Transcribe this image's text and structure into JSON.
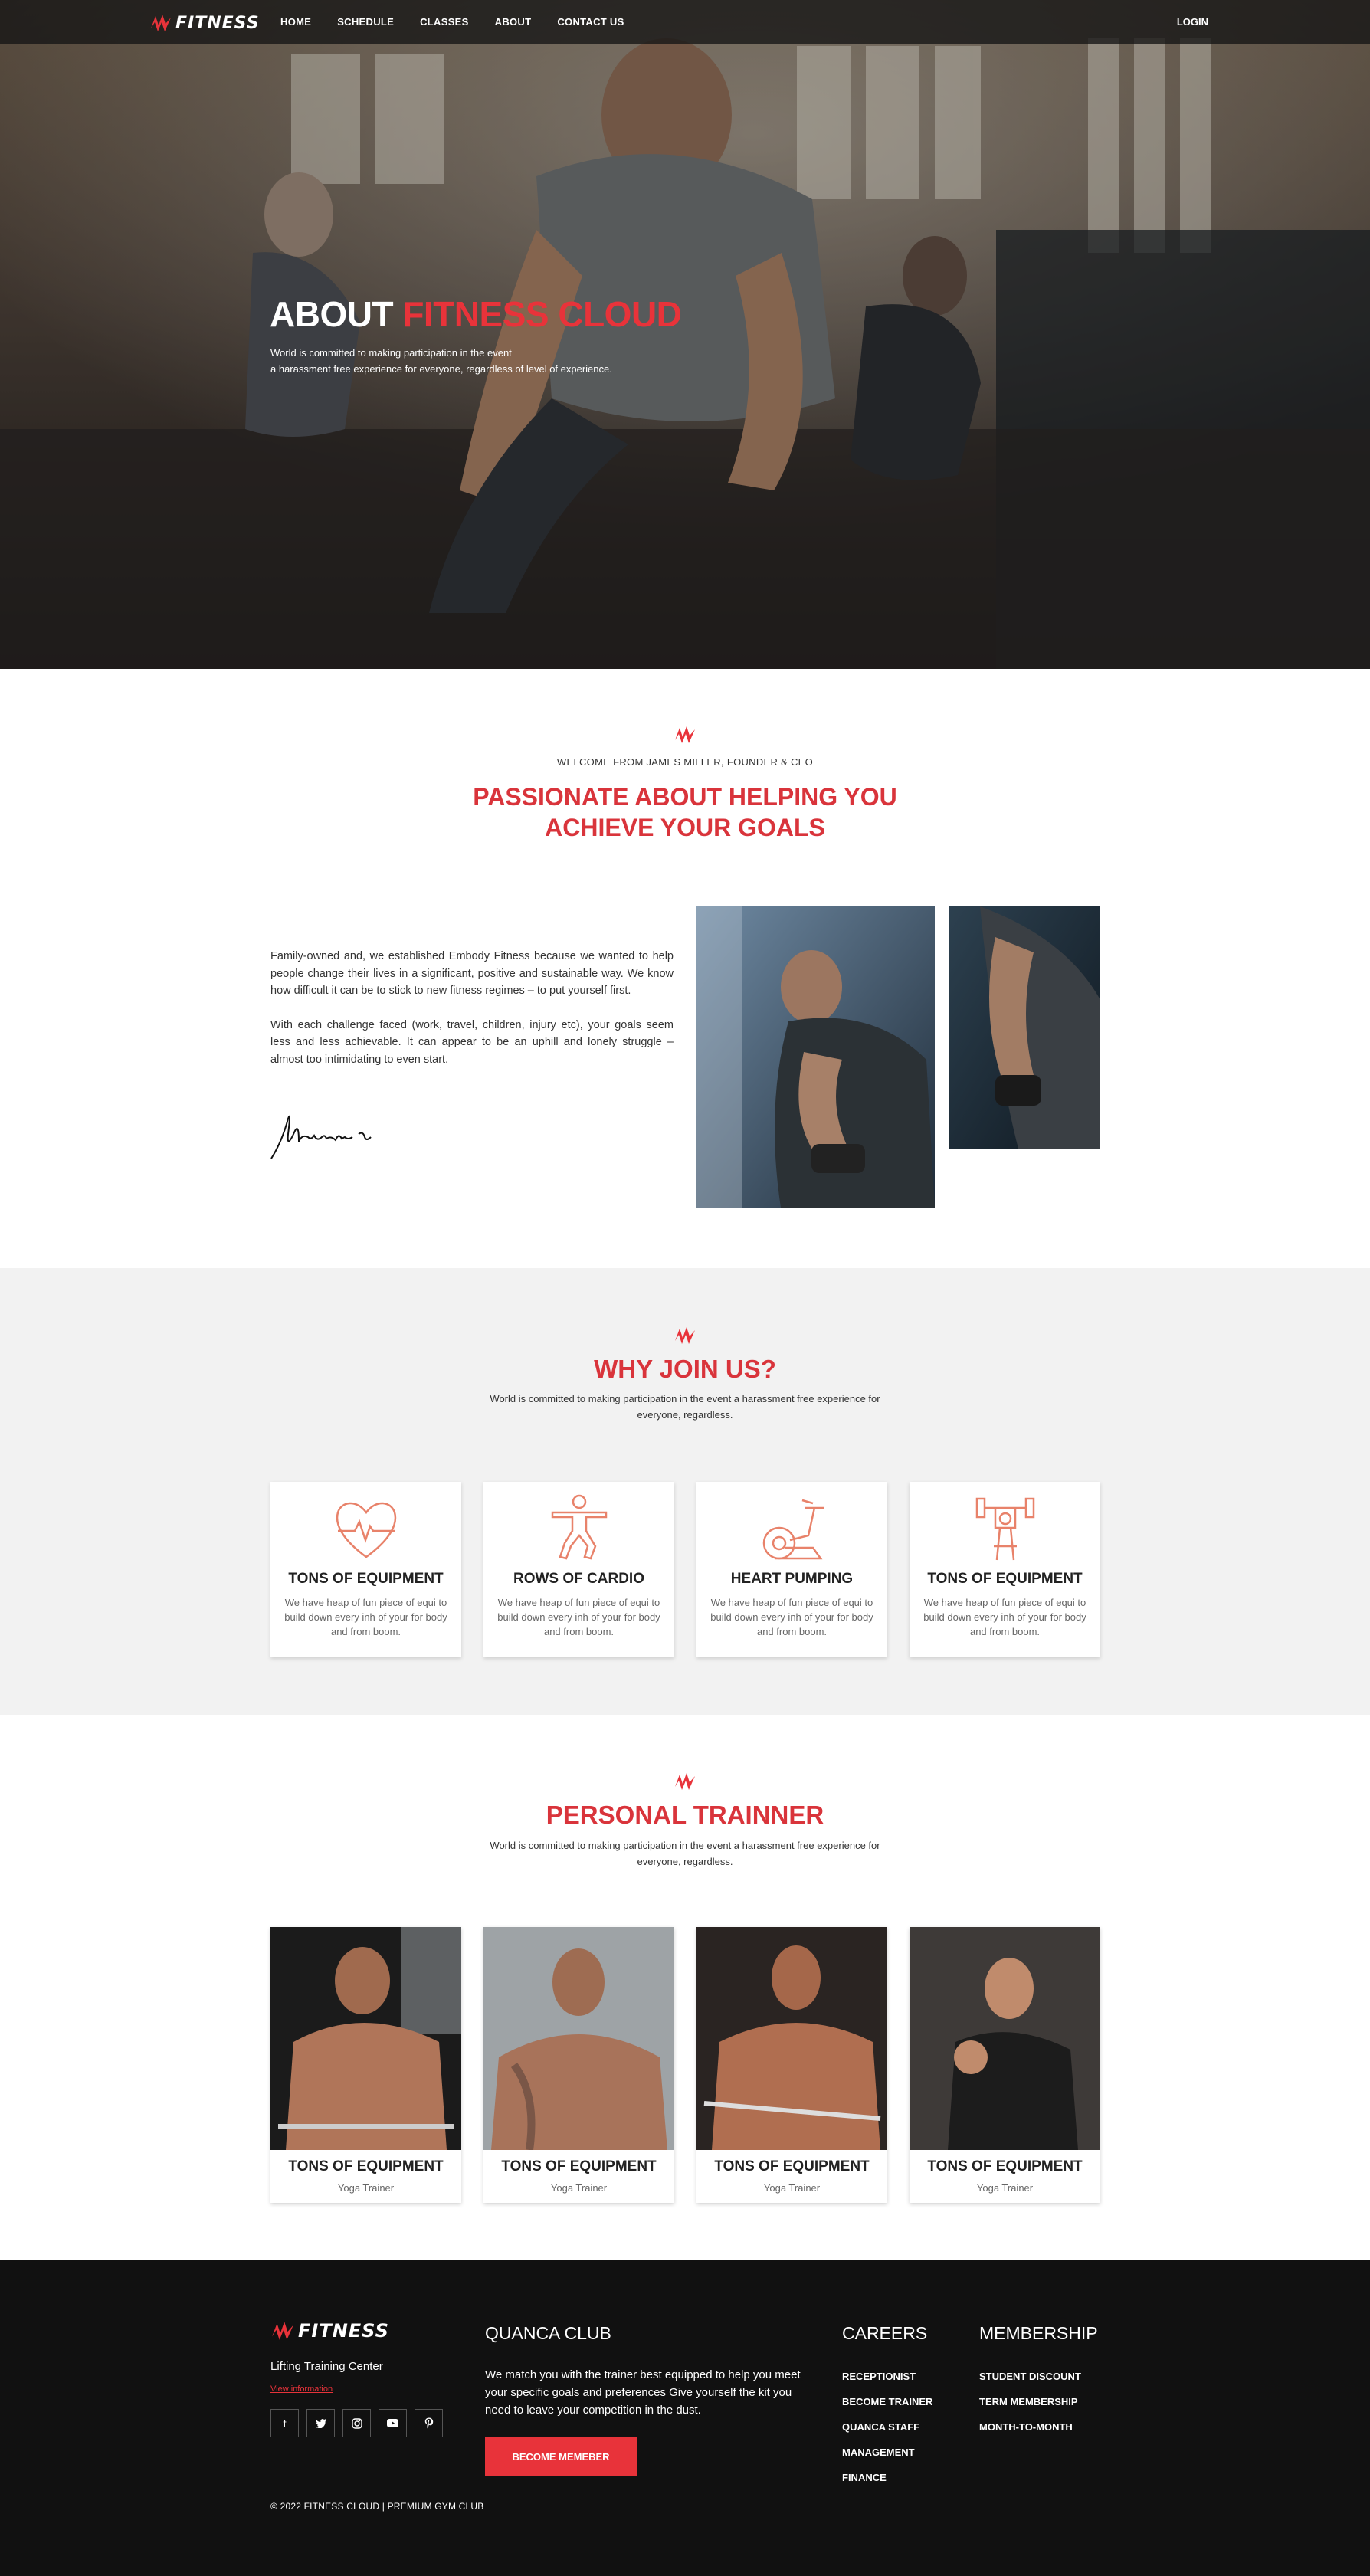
{
  "brand": {
    "name": "FITNESS",
    "accent": "#e8333a"
  },
  "nav": {
    "items": [
      "HOME",
      "SCHEDULE",
      "CLASSES",
      "ABOUT",
      "CONTACT US"
    ],
    "login": "LOGIN"
  },
  "hero": {
    "title_prefix": "ABOUT ",
    "title_highlight": "FITNESS CLOUD",
    "subtitle_line1": "World is committed to making participation in the event",
    "subtitle_line2": "a harassment free experience for everyone, regardless of level of experience."
  },
  "welcome": {
    "kicker": "WELCOME FROM JAMES MILLER, FOUNDER & CEO",
    "title_line1": "PASSIONATE ABOUT HELPING YOU",
    "title_line2": "ACHIEVE YOUR GOALS",
    "paragraph1": "Family-owned and, we established Embody Fitness because we wanted to help people change their lives in a significant, positive and sustainable way. We know how difficult it can be to stick to new fitness regimes – to put yourself first.",
    "paragraph2": "With each challenge faced (work, travel, children, injury etc), your goals seem less and less achievable. It can appear to be an uphill and lonely struggle – almost too intimidating to even start."
  },
  "why": {
    "title": "WHY JOIN US?",
    "subtitle": "World is committed to making participation in the event a harassment free experience for everyone, regardless.",
    "features": [
      {
        "icon": "heart-pulse-icon",
        "title": "TONS OF EQUIPMENT",
        "text": "We have heap of fun piece of equi to build down every inh of your for body and from boom."
      },
      {
        "icon": "yoga-pose-icon",
        "title": "ROWS OF CARDIO",
        "text": "We have heap of fun piece of equi to build down every inh of your for body and from boom."
      },
      {
        "icon": "exercise-bike-icon",
        "title": "HEART PUMPING",
        "text": "We have heap of fun piece of equi to build down every inh of your for body and from boom."
      },
      {
        "icon": "weightlifter-icon",
        "title": "TONS OF EQUIPMENT",
        "text": "We have heap of fun piece of equi to build down every inh of your for body and from boom."
      }
    ]
  },
  "trainers": {
    "title": "PERSONAL TRAINNER",
    "subtitle": "World is committed to making participation in the event a harassment free experience for everyone, regardless.",
    "items": [
      {
        "name": "TONS OF EQUIPMENT",
        "role": "Yoga Trainer"
      },
      {
        "name": "TONS OF EQUIPMENT",
        "role": "Yoga Trainer"
      },
      {
        "name": "TONS OF EQUIPMENT",
        "role": "Yoga Trainer"
      },
      {
        "name": "TONS OF EQUIPMENT",
        "role": "Yoga Trainer"
      }
    ]
  },
  "footer": {
    "tagline": "Lifting Training Center",
    "link": "View information",
    "socials": [
      "facebook-icon",
      "twitter-icon",
      "instagram-icon",
      "youtube-icon",
      "pinterest-icon"
    ],
    "club_title": "QUANCA CLUB",
    "club_text": "We match you with the trainer best equipped to help you meet your specific goals and preferences Give yourself the kit you need to leave your competition in the dust.",
    "button": "BECOME MEMEBER",
    "careers_title": "CAREERS",
    "careers": [
      "RECEPTIONIST",
      "BECOME TRAINER",
      "QUANCA STAFF",
      "MANAGEMENT",
      "FINANCE"
    ],
    "membership_title": "MEMBERSHIP",
    "membership": [
      "STUDENT DISCOUNT",
      "TERM MEMBERSHIP",
      "MONTH-TO-MONTH"
    ],
    "copyright": "© 2022 FITNESS CLOUD | PREMIUM GYM CLUB"
  }
}
